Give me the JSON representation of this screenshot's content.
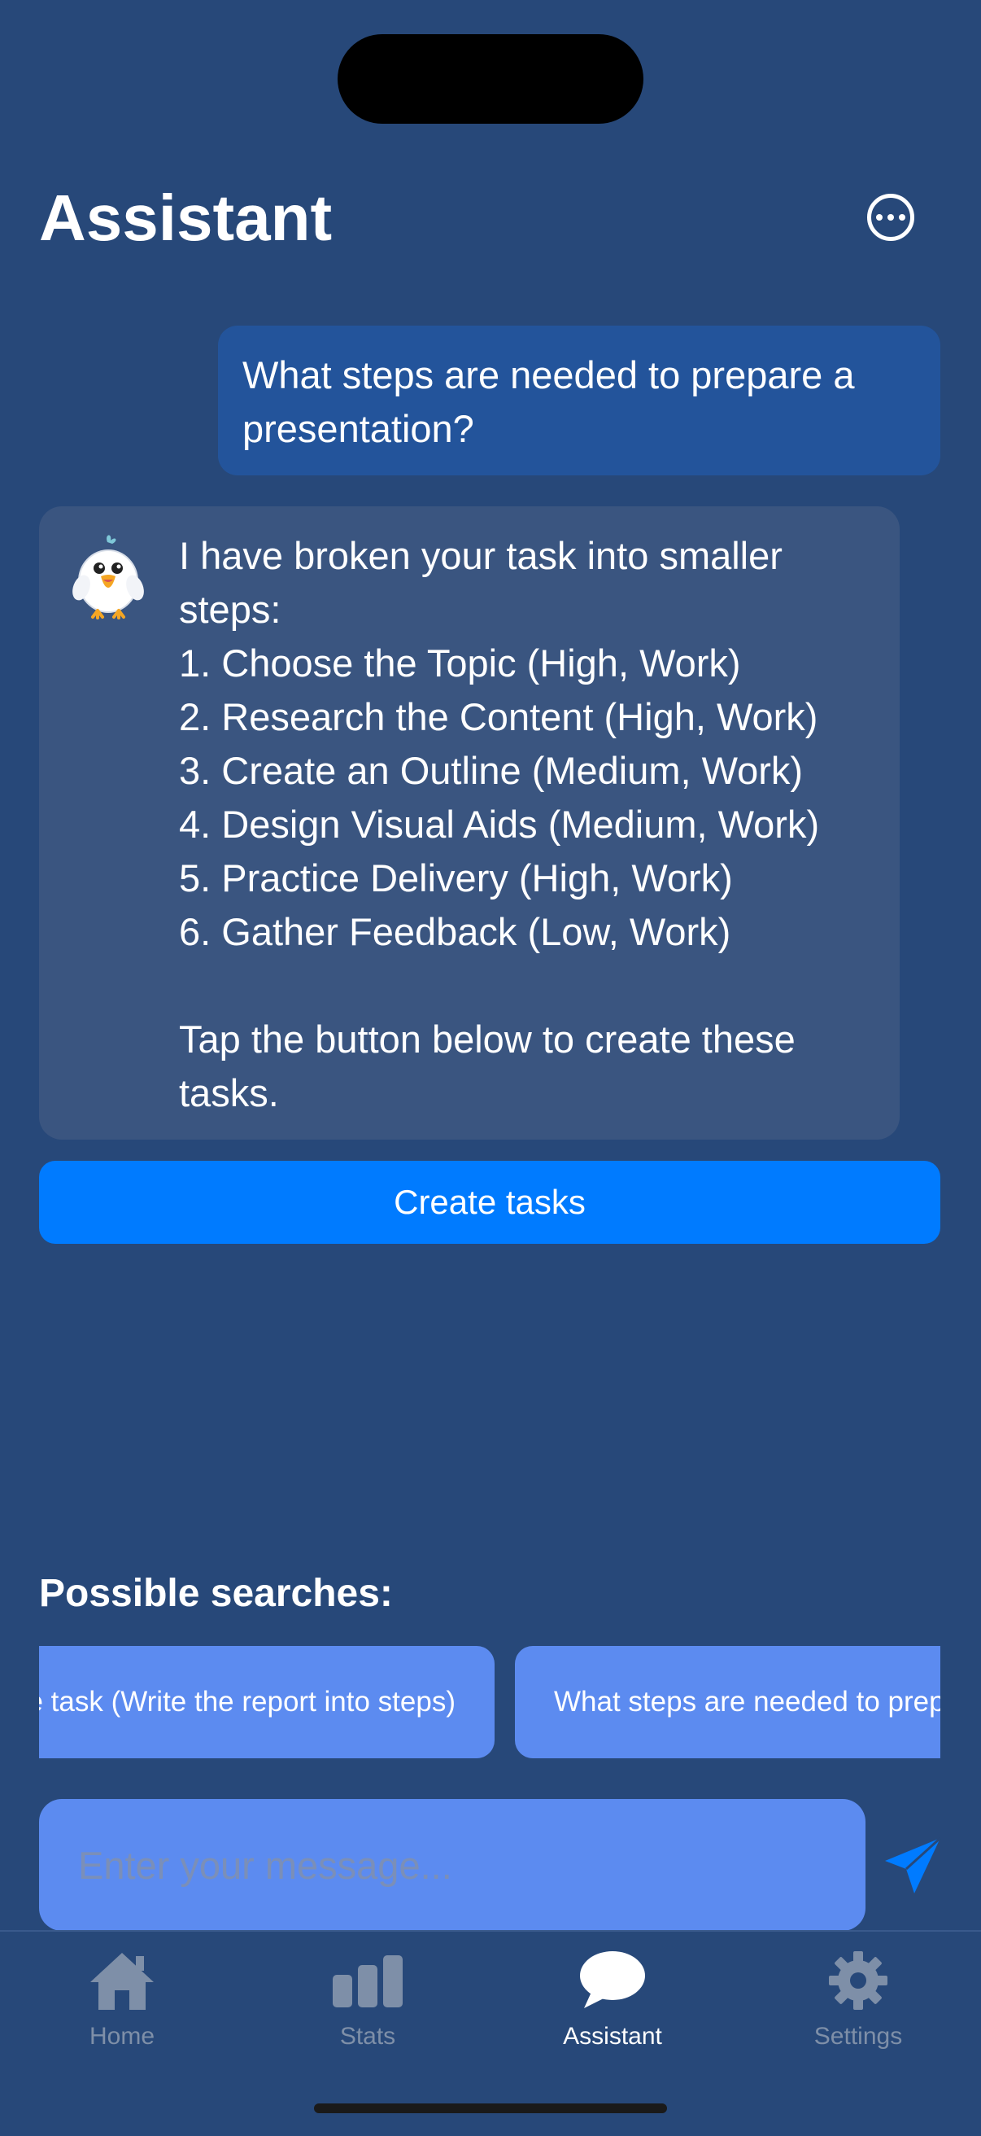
{
  "header": {
    "title": "Assistant",
    "more_icon": "ellipsis-circle-icon"
  },
  "conversation": {
    "user_message": "What steps are needed to prepare a presentation?",
    "assistant_message": "I have broken your task into smaller steps:\n1. Choose the Topic (High, Work)\n2. Research the Content (High, Work)\n3. Create an Outline (Medium, Work)\n4. Design Visual Aids (Medium, Work)\n5. Practice Delivery (High, Work)\n6. Gather Feedback (Low, Work)\n\nTap the button below to create these tasks.",
    "assistant_avatar": "bird-mascot-icon",
    "create_button_label": "Create tasks"
  },
  "suggestions": {
    "title": "Possible searches:",
    "items": [
      "Break down the task (Write the report into steps)",
      "What steps are needed to prepare a presentation?"
    ]
  },
  "composer": {
    "placeholder": "Enter your message...",
    "send_icon": "paper-plane-icon"
  },
  "tabbar": {
    "items": [
      {
        "label": "Home",
        "icon": "house-icon",
        "active": false
      },
      {
        "label": "Stats",
        "icon": "bar-chart-icon",
        "active": false
      },
      {
        "label": "Assistant",
        "icon": "chat-bubble-icon",
        "active": true
      },
      {
        "label": "Settings",
        "icon": "gear-icon",
        "active": false
      }
    ]
  },
  "colors": {
    "background": "#274879",
    "user_bubble": "#23549B",
    "assistant_bubble": "#3A5580",
    "primary_button": "#007BFF",
    "chip": "#5C8BF0",
    "tab_inactive": "#7E8FA8",
    "tab_active": "#FFFFFF"
  }
}
